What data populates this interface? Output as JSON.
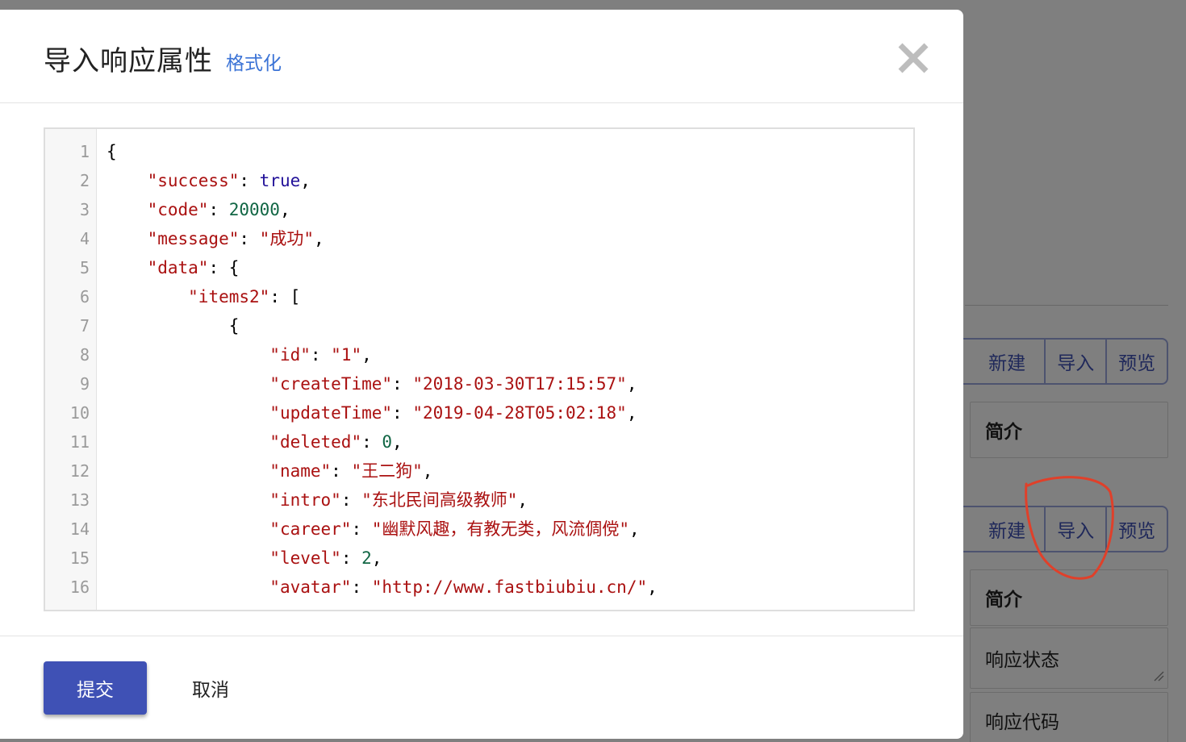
{
  "modal": {
    "title": "导入响应属性",
    "format_link": "格式化",
    "submit_label": "提交",
    "cancel_label": "取消"
  },
  "editor": {
    "line_numbers": [
      "1",
      "2",
      "3",
      "4",
      "5",
      "6",
      "7",
      "8",
      "9",
      "10",
      "11",
      "12",
      "13",
      "14",
      "15",
      "16"
    ],
    "lines": [
      [
        {
          "t": "{",
          "c": "punc"
        }
      ],
      [
        {
          "t": "    ",
          "c": "punc"
        },
        {
          "t": "\"success\"",
          "c": "str"
        },
        {
          "t": ": ",
          "c": "punc"
        },
        {
          "t": "true",
          "c": "atom"
        },
        {
          "t": ",",
          "c": "punc"
        }
      ],
      [
        {
          "t": "    ",
          "c": "punc"
        },
        {
          "t": "\"code\"",
          "c": "str"
        },
        {
          "t": ": ",
          "c": "punc"
        },
        {
          "t": "20000",
          "c": "num"
        },
        {
          "t": ",",
          "c": "punc"
        }
      ],
      [
        {
          "t": "    ",
          "c": "punc"
        },
        {
          "t": "\"message\"",
          "c": "str"
        },
        {
          "t": ": ",
          "c": "punc"
        },
        {
          "t": "\"成功\"",
          "c": "str"
        },
        {
          "t": ",",
          "c": "punc"
        }
      ],
      [
        {
          "t": "    ",
          "c": "punc"
        },
        {
          "t": "\"data\"",
          "c": "str"
        },
        {
          "t": ": {",
          "c": "punc"
        }
      ],
      [
        {
          "t": "        ",
          "c": "punc"
        },
        {
          "t": "\"items2\"",
          "c": "str"
        },
        {
          "t": ": [",
          "c": "punc"
        }
      ],
      [
        {
          "t": "            {",
          "c": "punc"
        }
      ],
      [
        {
          "t": "                ",
          "c": "punc"
        },
        {
          "t": "\"id\"",
          "c": "str"
        },
        {
          "t": ": ",
          "c": "punc"
        },
        {
          "t": "\"1\"",
          "c": "str"
        },
        {
          "t": ",",
          "c": "punc"
        }
      ],
      [
        {
          "t": "                ",
          "c": "punc"
        },
        {
          "t": "\"createTime\"",
          "c": "str"
        },
        {
          "t": ": ",
          "c": "punc"
        },
        {
          "t": "\"2018-03-30T17:15:57\"",
          "c": "str"
        },
        {
          "t": ",",
          "c": "punc"
        }
      ],
      [
        {
          "t": "                ",
          "c": "punc"
        },
        {
          "t": "\"updateTime\"",
          "c": "str"
        },
        {
          "t": ": ",
          "c": "punc"
        },
        {
          "t": "\"2019-04-28T05:02:18\"",
          "c": "str"
        },
        {
          "t": ",",
          "c": "punc"
        }
      ],
      [
        {
          "t": "                ",
          "c": "punc"
        },
        {
          "t": "\"deleted\"",
          "c": "str"
        },
        {
          "t": ": ",
          "c": "punc"
        },
        {
          "t": "0",
          "c": "num"
        },
        {
          "t": ",",
          "c": "punc"
        }
      ],
      [
        {
          "t": "                ",
          "c": "punc"
        },
        {
          "t": "\"name\"",
          "c": "str"
        },
        {
          "t": ": ",
          "c": "punc"
        },
        {
          "t": "\"王二狗\"",
          "c": "str"
        },
        {
          "t": ",",
          "c": "punc"
        }
      ],
      [
        {
          "t": "                ",
          "c": "punc"
        },
        {
          "t": "\"intro\"",
          "c": "str"
        },
        {
          "t": ": ",
          "c": "punc"
        },
        {
          "t": "\"东北民间高级教师\"",
          "c": "str"
        },
        {
          "t": ",",
          "c": "punc"
        }
      ],
      [
        {
          "t": "                ",
          "c": "punc"
        },
        {
          "t": "\"career\"",
          "c": "str"
        },
        {
          "t": ": ",
          "c": "punc"
        },
        {
          "t": "\"幽默风趣，有教无类，风流倜傥\"",
          "c": "str"
        },
        {
          "t": ",",
          "c": "punc"
        }
      ],
      [
        {
          "t": "                ",
          "c": "punc"
        },
        {
          "t": "\"level\"",
          "c": "str"
        },
        {
          "t": ": ",
          "c": "punc"
        },
        {
          "t": "2",
          "c": "num"
        },
        {
          "t": ",",
          "c": "punc"
        }
      ],
      [
        {
          "t": "                ",
          "c": "punc"
        },
        {
          "t": "\"avatar\"",
          "c": "str"
        },
        {
          "t": ": ",
          "c": "punc"
        },
        {
          "t": "\"http://www.fastbiubiu.cn/\"",
          "c": "str"
        },
        {
          "t": ",",
          "c": "punc"
        }
      ]
    ]
  },
  "background": {
    "group1": [
      "新建",
      "导入",
      "预览"
    ],
    "field1": "简介",
    "group2": [
      "新建",
      "导入",
      "预览"
    ],
    "field2": "简介",
    "field3": "响应状态",
    "field4": "响应代码"
  },
  "colors": {
    "primary": "#3f51b5",
    "link": "#3b73d6",
    "string": "#aa1111",
    "atom": "#221199",
    "number": "#116644",
    "annotation": "#e0402a"
  }
}
